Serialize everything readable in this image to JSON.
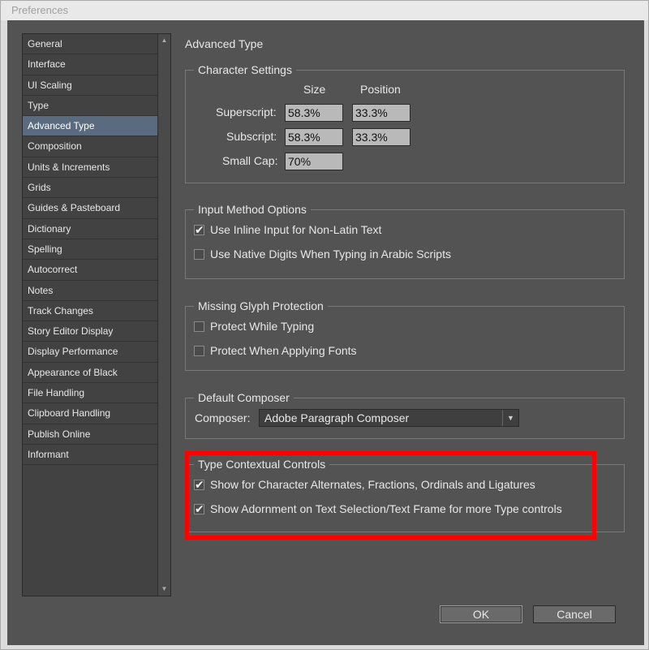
{
  "window": {
    "title": "Preferences"
  },
  "sidebar": {
    "items": [
      {
        "label": "General",
        "selected": false
      },
      {
        "label": "Interface",
        "selected": false
      },
      {
        "label": "UI Scaling",
        "selected": false
      },
      {
        "label": "Type",
        "selected": false
      },
      {
        "label": "Advanced Type",
        "selected": true
      },
      {
        "label": "Composition",
        "selected": false
      },
      {
        "label": "Units & Increments",
        "selected": false
      },
      {
        "label": "Grids",
        "selected": false
      },
      {
        "label": "Guides & Pasteboard",
        "selected": false
      },
      {
        "label": "Dictionary",
        "selected": false
      },
      {
        "label": "Spelling",
        "selected": false
      },
      {
        "label": "Autocorrect",
        "selected": false
      },
      {
        "label": "Notes",
        "selected": false
      },
      {
        "label": "Track Changes",
        "selected": false
      },
      {
        "label": "Story Editor Display",
        "selected": false
      },
      {
        "label": "Display Performance",
        "selected": false
      },
      {
        "label": "Appearance of Black",
        "selected": false
      },
      {
        "label": "File Handling",
        "selected": false
      },
      {
        "label": "Clipboard Handling",
        "selected": false
      },
      {
        "label": "Publish Online",
        "selected": false
      },
      {
        "label": "Informant",
        "selected": false
      }
    ],
    "scroll_up_icon": "triangle-up-icon",
    "scroll_down_icon": "triangle-down-icon"
  },
  "panel": {
    "title": "Advanced Type"
  },
  "character_settings": {
    "legend": "Character Settings",
    "col_size": "Size",
    "col_position": "Position",
    "superscript_label": "Superscript:",
    "superscript_size": "58.3%",
    "superscript_position": "33.3%",
    "subscript_label": "Subscript:",
    "subscript_size": "58.3%",
    "subscript_position": "33.3%",
    "smallcap_label": "Small Cap:",
    "smallcap_size": "70%"
  },
  "input_method": {
    "legend": "Input Method Options",
    "inline_input_label": "Use Inline Input for Non-Latin Text",
    "inline_input_checked": true,
    "native_digits_label": "Use Native Digits When Typing in Arabic Scripts",
    "native_digits_checked": false
  },
  "missing_glyph": {
    "legend": "Missing Glyph Protection",
    "protect_typing_label": "Protect While Typing",
    "protect_typing_checked": false,
    "protect_fonts_label": "Protect When Applying Fonts",
    "protect_fonts_checked": false
  },
  "default_composer": {
    "legend": "Default Composer",
    "composer_label": "Composer:",
    "composer_value": "Adobe Paragraph Composer"
  },
  "type_contextual": {
    "legend": "Type Contextual Controls",
    "alternates_label": "Show for Character Alternates, Fractions, Ordinals and Ligatures",
    "alternates_checked": true,
    "adornment_label": "Show Adornment on Text Selection/Text Frame for more Type controls",
    "adornment_checked": true
  },
  "buttons": {
    "ok": "OK",
    "cancel": "Cancel"
  },
  "colors": {
    "client_bg": "#535353",
    "selected_item": "#5a6b80",
    "highlight": "#ff0000"
  }
}
